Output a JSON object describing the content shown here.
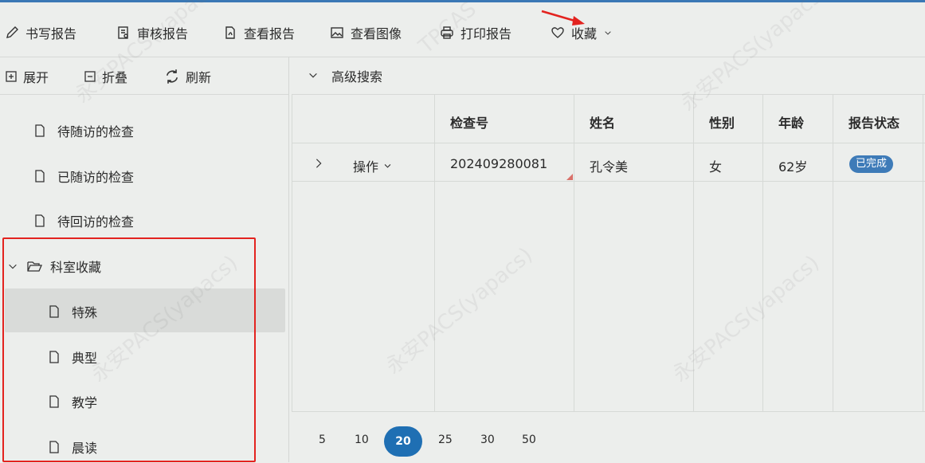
{
  "toolbar": {
    "write_report": "书写报告",
    "review_report": "审核报告",
    "view_report": "查看报告",
    "view_image": "查看图像",
    "print_report": "打印报告",
    "favorites": "收藏"
  },
  "tree_tools": {
    "expand": "展开",
    "collapse": "折叠",
    "refresh": "刷新"
  },
  "tree": {
    "nodes": [
      "待随访的检查",
      "已随访的检查",
      "待回访的检查"
    ],
    "folder": "科室收藏",
    "children": [
      "特殊",
      "典型",
      "教学",
      "晨读"
    ]
  },
  "advanced_search": "高级搜索",
  "table": {
    "headers": [
      "检查号",
      "姓名",
      "性别",
      "年龄",
      "报告状态"
    ],
    "row": {
      "action": "操作",
      "exam_no": "202409280081",
      "name": "孔令美",
      "gender": "女",
      "age": "62岁",
      "status": "已完成"
    }
  },
  "pager": {
    "sizes": [
      "5",
      "10",
      "20",
      "25",
      "30",
      "50"
    ],
    "active": "20"
  },
  "watermark": {
    "line1": "永安PACS(yapacs)",
    "line2": "TPCAS"
  },
  "colors": {
    "accent": "#1f6fb3",
    "badge": "#3e7bb8",
    "highlight": "#e3231f"
  }
}
